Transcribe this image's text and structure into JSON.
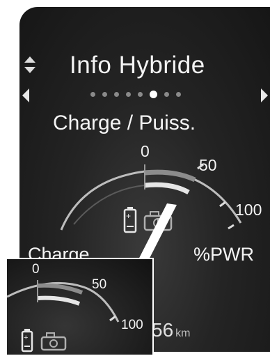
{
  "header": {
    "title": "Info Hybride",
    "subtitle": "Charge / Puiss."
  },
  "pager": {
    "page_count": 8,
    "active_index": 5
  },
  "gauge": {
    "tick_0": "0",
    "tick_50": "50",
    "tick_100": "100",
    "label_left": "Charge",
    "label_right": "%PWR"
  },
  "odometer": {
    "value": "56",
    "unit": "km"
  },
  "inset": {
    "tick_0": "0",
    "tick_50": "50",
    "tick_100": "100"
  },
  "colors": {
    "background": "#1e1e1e",
    "text": "#f4f4f4",
    "charge_bar": "#e6e6e6",
    "power_bar": "#8c8c8c"
  },
  "icons": {
    "battery": "battery-icon",
    "engine": "engine-icon",
    "nav": "chevron-icon"
  }
}
